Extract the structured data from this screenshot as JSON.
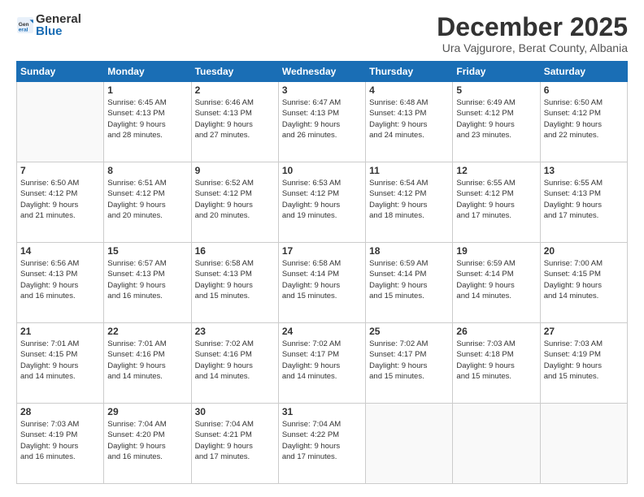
{
  "logo": {
    "line1": "General",
    "line2": "Blue"
  },
  "header": {
    "month": "December 2025",
    "location": "Ura Vajgurore, Berat County, Albania"
  },
  "weekdays": [
    "Sunday",
    "Monday",
    "Tuesday",
    "Wednesday",
    "Thursday",
    "Friday",
    "Saturday"
  ],
  "weeks": [
    [
      {
        "day": "",
        "info": ""
      },
      {
        "day": "1",
        "info": "Sunrise: 6:45 AM\nSunset: 4:13 PM\nDaylight: 9 hours\nand 28 minutes."
      },
      {
        "day": "2",
        "info": "Sunrise: 6:46 AM\nSunset: 4:13 PM\nDaylight: 9 hours\nand 27 minutes."
      },
      {
        "day": "3",
        "info": "Sunrise: 6:47 AM\nSunset: 4:13 PM\nDaylight: 9 hours\nand 26 minutes."
      },
      {
        "day": "4",
        "info": "Sunrise: 6:48 AM\nSunset: 4:13 PM\nDaylight: 9 hours\nand 24 minutes."
      },
      {
        "day": "5",
        "info": "Sunrise: 6:49 AM\nSunset: 4:12 PM\nDaylight: 9 hours\nand 23 minutes."
      },
      {
        "day": "6",
        "info": "Sunrise: 6:50 AM\nSunset: 4:12 PM\nDaylight: 9 hours\nand 22 minutes."
      }
    ],
    [
      {
        "day": "7",
        "info": "Sunrise: 6:50 AM\nSunset: 4:12 PM\nDaylight: 9 hours\nand 21 minutes."
      },
      {
        "day": "8",
        "info": "Sunrise: 6:51 AM\nSunset: 4:12 PM\nDaylight: 9 hours\nand 20 minutes."
      },
      {
        "day": "9",
        "info": "Sunrise: 6:52 AM\nSunset: 4:12 PM\nDaylight: 9 hours\nand 20 minutes."
      },
      {
        "day": "10",
        "info": "Sunrise: 6:53 AM\nSunset: 4:12 PM\nDaylight: 9 hours\nand 19 minutes."
      },
      {
        "day": "11",
        "info": "Sunrise: 6:54 AM\nSunset: 4:12 PM\nDaylight: 9 hours\nand 18 minutes."
      },
      {
        "day": "12",
        "info": "Sunrise: 6:55 AM\nSunset: 4:12 PM\nDaylight: 9 hours\nand 17 minutes."
      },
      {
        "day": "13",
        "info": "Sunrise: 6:55 AM\nSunset: 4:13 PM\nDaylight: 9 hours\nand 17 minutes."
      }
    ],
    [
      {
        "day": "14",
        "info": "Sunrise: 6:56 AM\nSunset: 4:13 PM\nDaylight: 9 hours\nand 16 minutes."
      },
      {
        "day": "15",
        "info": "Sunrise: 6:57 AM\nSunset: 4:13 PM\nDaylight: 9 hours\nand 16 minutes."
      },
      {
        "day": "16",
        "info": "Sunrise: 6:58 AM\nSunset: 4:13 PM\nDaylight: 9 hours\nand 15 minutes."
      },
      {
        "day": "17",
        "info": "Sunrise: 6:58 AM\nSunset: 4:14 PM\nDaylight: 9 hours\nand 15 minutes."
      },
      {
        "day": "18",
        "info": "Sunrise: 6:59 AM\nSunset: 4:14 PM\nDaylight: 9 hours\nand 15 minutes."
      },
      {
        "day": "19",
        "info": "Sunrise: 6:59 AM\nSunset: 4:14 PM\nDaylight: 9 hours\nand 14 minutes."
      },
      {
        "day": "20",
        "info": "Sunrise: 7:00 AM\nSunset: 4:15 PM\nDaylight: 9 hours\nand 14 minutes."
      }
    ],
    [
      {
        "day": "21",
        "info": "Sunrise: 7:01 AM\nSunset: 4:15 PM\nDaylight: 9 hours\nand 14 minutes."
      },
      {
        "day": "22",
        "info": "Sunrise: 7:01 AM\nSunset: 4:16 PM\nDaylight: 9 hours\nand 14 minutes."
      },
      {
        "day": "23",
        "info": "Sunrise: 7:02 AM\nSunset: 4:16 PM\nDaylight: 9 hours\nand 14 minutes."
      },
      {
        "day": "24",
        "info": "Sunrise: 7:02 AM\nSunset: 4:17 PM\nDaylight: 9 hours\nand 14 minutes."
      },
      {
        "day": "25",
        "info": "Sunrise: 7:02 AM\nSunset: 4:17 PM\nDaylight: 9 hours\nand 15 minutes."
      },
      {
        "day": "26",
        "info": "Sunrise: 7:03 AM\nSunset: 4:18 PM\nDaylight: 9 hours\nand 15 minutes."
      },
      {
        "day": "27",
        "info": "Sunrise: 7:03 AM\nSunset: 4:19 PM\nDaylight: 9 hours\nand 15 minutes."
      }
    ],
    [
      {
        "day": "28",
        "info": "Sunrise: 7:03 AM\nSunset: 4:19 PM\nDaylight: 9 hours\nand 16 minutes."
      },
      {
        "day": "29",
        "info": "Sunrise: 7:04 AM\nSunset: 4:20 PM\nDaylight: 9 hours\nand 16 minutes."
      },
      {
        "day": "30",
        "info": "Sunrise: 7:04 AM\nSunset: 4:21 PM\nDaylight: 9 hours\nand 17 minutes."
      },
      {
        "day": "31",
        "info": "Sunrise: 7:04 AM\nSunset: 4:22 PM\nDaylight: 9 hours\nand 17 minutes."
      },
      {
        "day": "",
        "info": ""
      },
      {
        "day": "",
        "info": ""
      },
      {
        "day": "",
        "info": ""
      }
    ]
  ]
}
